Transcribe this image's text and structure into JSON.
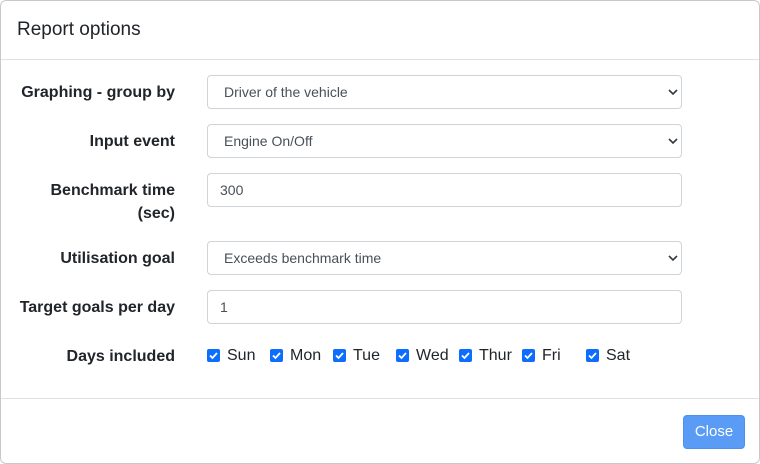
{
  "modal": {
    "title": "Report options",
    "close_label": "Close"
  },
  "form": {
    "graphing": {
      "label": "Graphing - group by",
      "selected": "Driver of the vehicle"
    },
    "input_event": {
      "label": "Input event",
      "selected": "Engine On/Off"
    },
    "benchmark": {
      "label_line1": "Benchmark time",
      "label_line2": "(sec)",
      "value": "300"
    },
    "utilisation": {
      "label": "Utilisation goal",
      "selected": "Exceeds benchmark time"
    },
    "target_goals": {
      "label": "Target goals per day",
      "value": "1"
    },
    "days": {
      "label": "Days included",
      "items": [
        {
          "label": "Sun",
          "checked": true
        },
        {
          "label": "Mon",
          "checked": true
        },
        {
          "label": "Tue",
          "checked": true
        },
        {
          "label": "Wed",
          "checked": true
        },
        {
          "label": "Thur",
          "checked": true
        },
        {
          "label": "Fri",
          "checked": true
        },
        {
          "label": "Sat",
          "checked": true
        }
      ]
    }
  },
  "colors": {
    "primary": "#0d6efd",
    "close_button": "#5a9bf6"
  },
  "icons": {
    "select_arrow": "chevron-down-icon",
    "checkbox_mark": "check-icon"
  }
}
